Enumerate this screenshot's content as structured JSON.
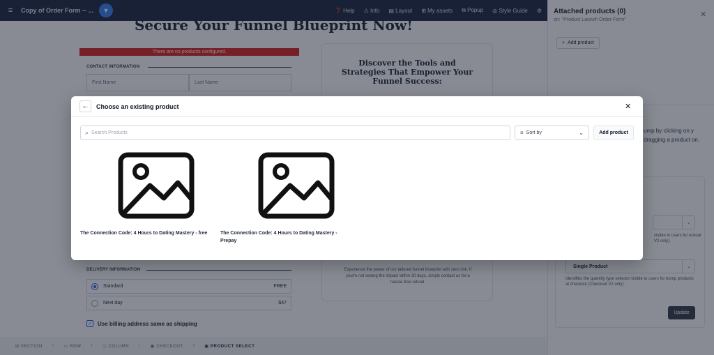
{
  "topbar": {
    "title": "Copy of Order Form -- ...",
    "nav": [
      {
        "icon": "help-circle-icon",
        "glyph": "❓",
        "label": "Help"
      },
      {
        "icon": "info-icon",
        "glyph": "⚠",
        "label": "Info"
      },
      {
        "icon": "layout-icon",
        "glyph": "▤",
        "label": "Layout"
      },
      {
        "icon": "assets-icon",
        "glyph": "⊞",
        "label": "My assets"
      },
      {
        "icon": "popup-icon",
        "glyph": "⧉",
        "label": "Popup"
      },
      {
        "icon": "style-guide-icon",
        "glyph": "◎",
        "label": "Style Guide"
      }
    ]
  },
  "canvas": {
    "headline": "Secure Your Funnel Blueprint Now!",
    "alert": "There are no products configured.",
    "contact_label": "CONTACT INFORMATION",
    "first_name": "First Name",
    "last_name": "Last Name",
    "delivery_label": "DELIVERY INFORMATION",
    "shipping": [
      {
        "label": "Standard",
        "price": "FREE",
        "selected": true
      },
      {
        "label": "Next day",
        "price": "$47",
        "selected": false
      }
    ],
    "billing_same": "Use billing address same as shipping",
    "card_heading": "Discover the Tools and Strategies That Empower Your Funnel Success:",
    "card_text": "Experience the power of our tailored funnel blueprint with zero risk. If you're not seeing the impact within 30 days, simply contact us for a hassle-free refund."
  },
  "breadcrumb": [
    {
      "label": "SECTION",
      "active": false
    },
    {
      "label": "ROW",
      "active": false
    },
    {
      "label": "COLUMN",
      "active": false
    },
    {
      "label": "CHECKOUT",
      "active": false
    },
    {
      "label": "PRODUCT SELECT",
      "active": true
    }
  ],
  "panel": {
    "title": "Attached products (0)",
    "subtitle": "on: \"Product Launch Order Form\"",
    "add_product": "Add product",
    "hint": "ump by clicking on y dragging a product on.",
    "quantity_value": "Single Product",
    "help_top": "visible to users for eckout V2 only).",
    "help_quantity": "Identifies the quantity type selector visible to users for bump products at checkout (Checkout V2 only).",
    "update": "Update"
  },
  "modal": {
    "title": "Choose an existing product",
    "search_placeholder": "Search Products",
    "sort_label": "Sort by",
    "add_product": "Add product",
    "products": [
      {
        "name": "The Connection Code: 4 Hours to Dating Mastery - free"
      },
      {
        "name": "The Connection Code: 4 Hours to Dating Mastery - Prepay"
      }
    ]
  }
}
